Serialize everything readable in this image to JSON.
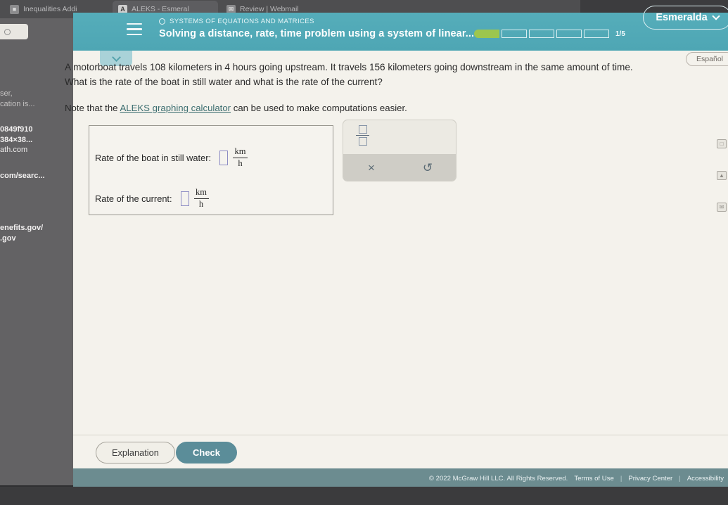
{
  "browser": {
    "tabs": [
      {
        "title": "Inequalities Addi",
        "favicon": "doc-icon",
        "active": false
      },
      {
        "title": "ALEKS - Esmeral",
        "favicon": "aleks-icon",
        "active": true
      },
      {
        "title": "Review | Webmail",
        "favicon": "mail-icon",
        "active": false
      }
    ],
    "sidebar": {
      "search_placeholder": "",
      "entries": [
        {
          "lines": [
            "ser,",
            "cation is..."
          ],
          "style": "dim"
        },
        {
          "lines": [
            "0849f910",
            "384×38...",
            "ath.com"
          ],
          "style": "bold"
        },
        {
          "lines": [
            "com/searc..."
          ],
          "style": "bold"
        },
        {
          "lines": [
            "enefits.gov/",
            ".gov"
          ],
          "style": "bold"
        }
      ]
    }
  },
  "header": {
    "kicker": "SYSTEMS OF EQUATIONS AND MATRICES",
    "title": "Solving a distance, rate, time problem using a system of linear...",
    "menu_icon": "hamburger-icon",
    "progress": {
      "total": 5,
      "completed": 1,
      "label": "1/5"
    },
    "user": {
      "name": "Esmeralda",
      "chevron": "chevron-down-icon"
    },
    "language_button": "Español",
    "collapse_chevron": "chevron-down-icon"
  },
  "problem": {
    "line1": "A motorboat travels 108 kilometers in 4 hours going upstream. It travels 156 kilometers going downstream in the same amount of time.",
    "line2": "What is the rate of the boat in still water and what is the rate of the current?",
    "note_prefix": "Note that the ",
    "note_link": "ALEKS graphing calculator",
    "note_suffix": " can be used to make computations easier."
  },
  "answers": {
    "rows": [
      {
        "label": "Rate of the boat in still water:",
        "value": "",
        "unit_numerator": "km",
        "unit_denominator": "h"
      },
      {
        "label": "Rate of the current:",
        "value": "",
        "unit_numerator": "km",
        "unit_denominator": "h"
      }
    ]
  },
  "math_palette": {
    "fraction_button": "fraction-icon",
    "clear_button": "×",
    "undo_button": "↺"
  },
  "edge_icons": [
    "screenshot-icon",
    "image-icon",
    "mail-icon"
  ],
  "actions": {
    "explanation": "Explanation",
    "check": "Check"
  },
  "footer": {
    "copyright": "© 2022 McGraw Hill LLC. All Rights Reserved.",
    "links": [
      "Terms of Use",
      "Privacy Center",
      "Accessibility"
    ],
    "separator": "|"
  },
  "colors": {
    "header_teal": "#4ea6b4",
    "progress_green": "#9cc64e",
    "check_button": "#5b8d99",
    "footer_bar": "#6c8c90",
    "page_bg": "#f4f2ec",
    "input_outline": "#8d8cc4"
  }
}
